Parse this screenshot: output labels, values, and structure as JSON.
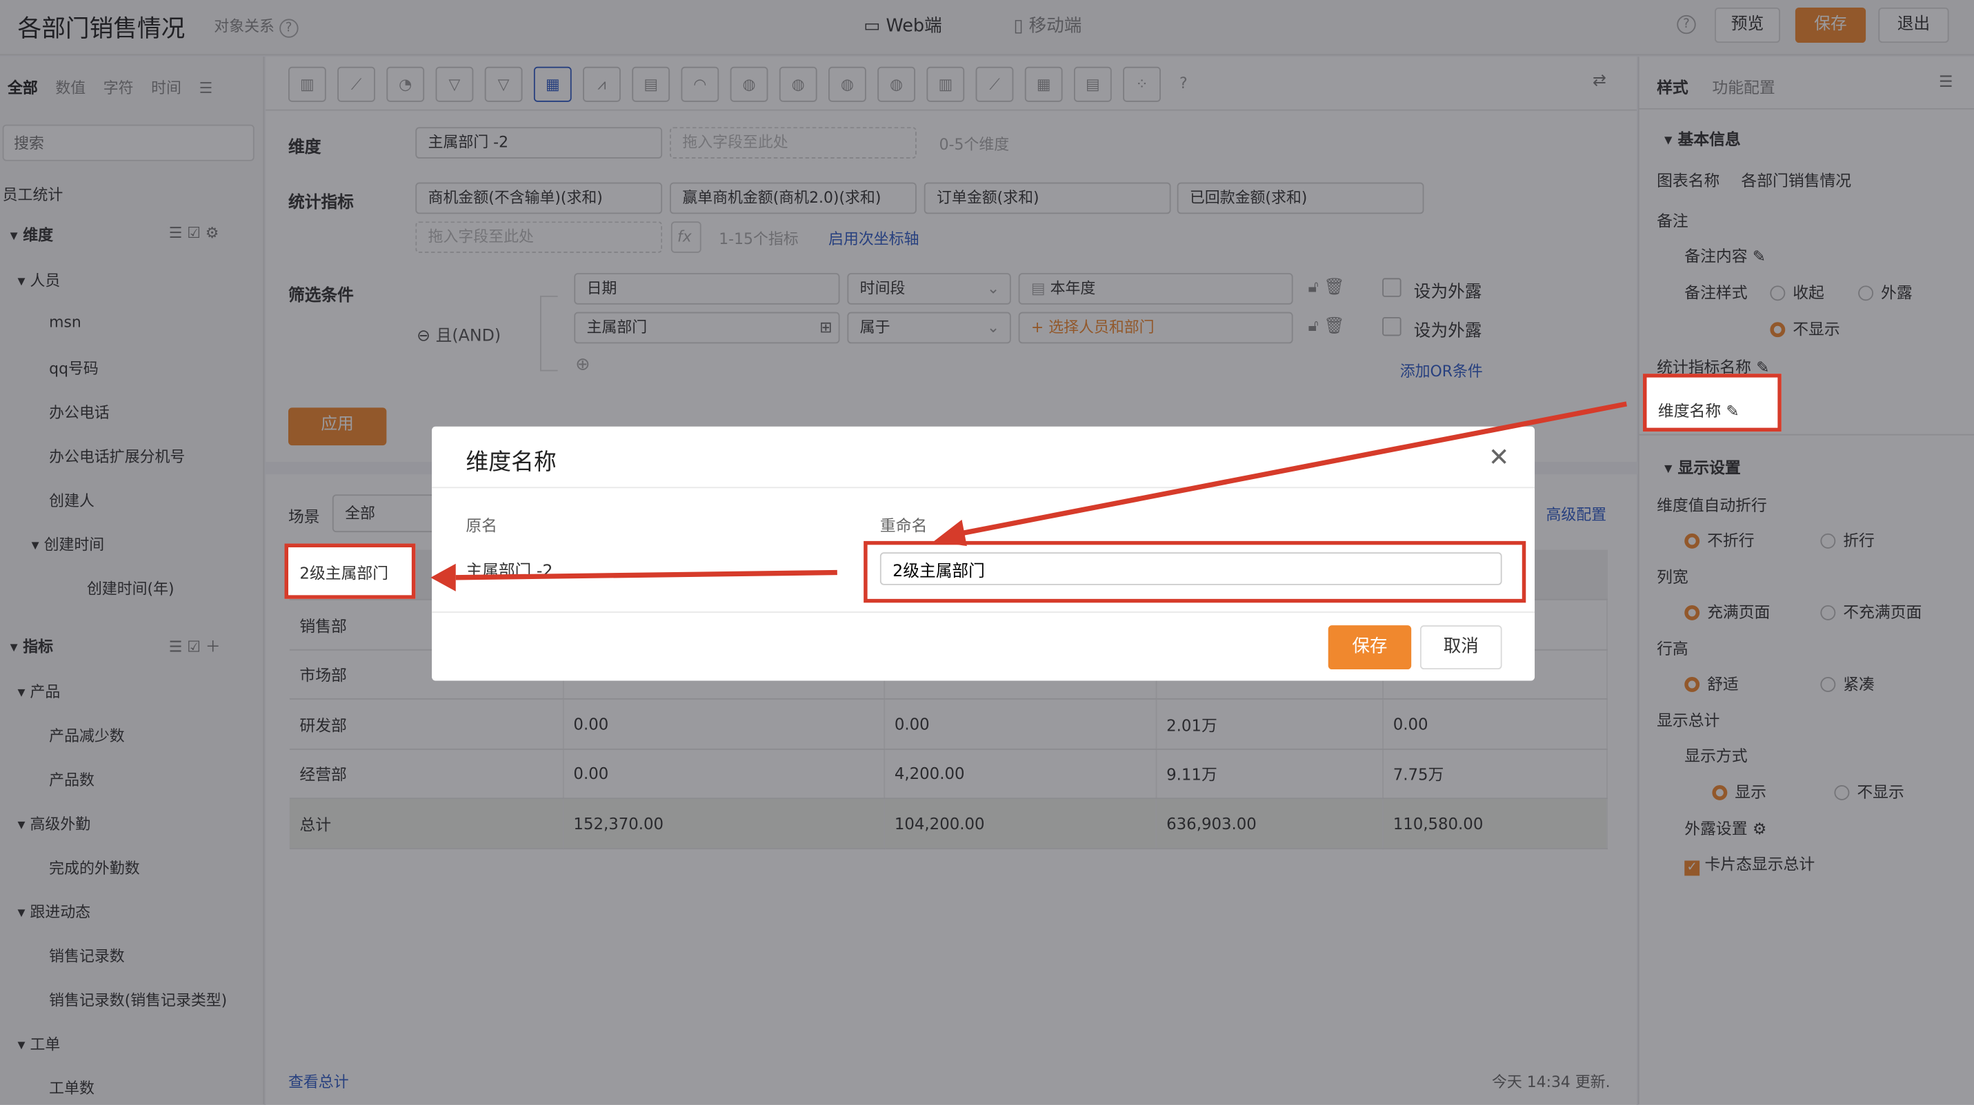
{
  "header": {
    "title": "各部门销售情况",
    "relation": "对象关系",
    "platform_web": "Web端",
    "platform_mobile": "移动端",
    "preview": "预览",
    "save": "保存",
    "exit": "退出"
  },
  "left": {
    "tabs": [
      "全部",
      "数值",
      "字符",
      "时间"
    ],
    "search_placeholder": "搜索",
    "group": "员工统计",
    "dimension": "维度",
    "metric": "指标",
    "dim_items": [
      "人员",
      "msn",
      "qq号码",
      "办公电话",
      "办公电话扩展分机号",
      "创建人",
      "创建时间",
      "创建时间(年)"
    ],
    "metric_items": [
      "产品",
      "产品减少数",
      "产品数",
      "高级外勤",
      "完成的外勤数",
      "跟进动态",
      "销售记录数",
      "销售记录数(销售记录类型)",
      "工单",
      "工单数"
    ]
  },
  "toolbar": {
    "icons": [
      "bar-chart",
      "line-chart",
      "pie-chart",
      "funnel",
      "funnel-alt",
      "table",
      "combo-chart",
      "card",
      "gauge",
      "map-cn",
      "map-cn-alt",
      "world-map",
      "globe",
      "column-chart",
      "area-chart",
      "pivot",
      "list-table",
      "scatter",
      "help"
    ]
  },
  "config": {
    "dimension_label": "维度",
    "dimension_value": "主属部门 -2",
    "drop_placeholder": "拖入字段至此处",
    "dimension_hint": "0-5个维度",
    "metric_label": "统计指标",
    "metrics": [
      "商机金额(不含输单)(求和)",
      "赢单商机金额(商机2.0)(求和)",
      "订单金额(求和)",
      "已回款金额(求和)"
    ],
    "metric_hint": "1-15个指标",
    "secondary_axis": "启用次坐标轴",
    "filter_label": "筛选条件",
    "logic": "且(AND)",
    "filters": [
      {
        "field": "日期",
        "op": "时间段",
        "value": "本年度",
        "expose": "设为外露"
      },
      {
        "field": "主属部门",
        "op": "属于",
        "value": "+ 选择人员和部门",
        "expose": "设为外露"
      }
    ],
    "add_or": "添加OR条件",
    "apply": "应用",
    "scene_label": "场景",
    "scene_value": "全部",
    "advanced": "高级配置"
  },
  "table": {
    "header_first": "2级主属部门",
    "rows": [
      {
        "name": "销售部",
        "values": [
          "",
          "",
          "",
          ""
        ]
      },
      {
        "name": "市场部",
        "values": [
          "",
          "",
          "",
          ""
        ]
      },
      {
        "name": "研发部",
        "values": [
          "0.00",
          "0.00",
          "2.01万",
          "0.00"
        ]
      },
      {
        "name": "经营部",
        "values": [
          "0.00",
          "4,200.00",
          "9.11万",
          "7.75万"
        ]
      },
      {
        "name": "总计",
        "values": [
          "152,370.00",
          "104,200.00",
          "636,903.00",
          "110,580.00"
        ]
      }
    ]
  },
  "footer": {
    "view_total": "查看总计",
    "updated": "今天 14:34 更新."
  },
  "right": {
    "tabs": [
      "样式",
      "功能配置"
    ],
    "basic": "基本信息",
    "chart_name_label": "图表名称",
    "chart_name": "各部门销售情况",
    "note": "备注",
    "note_content": "备注内容",
    "note_style": "备注样式",
    "collapse": "收起",
    "expose": "外露",
    "hide": "不显示",
    "metric_name": "统计指标名称",
    "dim_name": "维度名称",
    "display": "显示设置",
    "auto_wrap": "维度值自动折行",
    "no_wrap": "不折行",
    "wrap": "折行",
    "col_width": "列宽",
    "fill": "充满页面",
    "no_fill": "不充满页面",
    "row_height": "行高",
    "comfort": "舒适",
    "compact": "紧凑",
    "show_total": "显示总计",
    "show_mode": "显示方式",
    "show": "显示",
    "no_show": "不显示",
    "expose_set": "外露设置",
    "card_total": "卡片态显示总计"
  },
  "modal": {
    "title": "维度名称",
    "orig_label": "原名",
    "rename_label": "重命名",
    "orig_value": "主属部门 -2",
    "rename_value": "2级主属部门",
    "save": "保存",
    "cancel": "取消"
  },
  "colors": {
    "accent": "#f0882e",
    "link": "#2f5bc7",
    "annotation": "#d63b2a"
  }
}
